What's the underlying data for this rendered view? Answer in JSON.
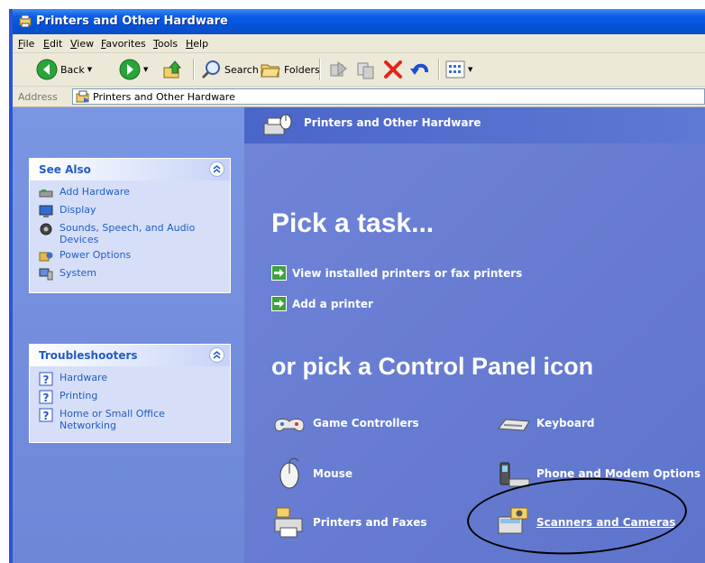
{
  "window": {
    "title": "Printers and Other Hardware"
  },
  "menu": [
    "File",
    "Edit",
    "View",
    "Favorites",
    "Tools",
    "Help"
  ],
  "toolbar": {
    "back": "Back",
    "search": "Search",
    "folders": "Folders"
  },
  "address": {
    "label": "Address",
    "value": "Printers and Other Hardware"
  },
  "see_also": {
    "title": "See Also",
    "items": [
      {
        "label": "Add Hardware",
        "icon": "add-hardware-icon"
      },
      {
        "label": "Display",
        "icon": "display-icon"
      },
      {
        "label": "Sounds, Speech, and Audio Devices",
        "icon": "speaker-icon"
      },
      {
        "label": "Power Options",
        "icon": "power-icon"
      },
      {
        "label": "System",
        "icon": "computer-icon"
      }
    ]
  },
  "troubleshooters": {
    "title": "Troubleshooters",
    "items": [
      {
        "label": "Hardware",
        "icon": "help-icon"
      },
      {
        "label": "Printing",
        "icon": "help-icon"
      },
      {
        "label": "Home or Small Office Networking",
        "icon": "help-icon"
      }
    ]
  },
  "content": {
    "header": "Printers and Other Hardware",
    "pick_task": "Pick a task...",
    "tasks": [
      "View installed printers or fax printers",
      "Add a printer"
    ],
    "pick_icon": "or pick a Control Panel icon",
    "icons": [
      "Game Controllers",
      "Keyboard",
      "Mouse",
      "Phone and Modem Options",
      "Printers and Faxes",
      "Scanners and Cameras"
    ]
  },
  "colors": {
    "title_bar": "#0a5ce6",
    "task_pane": "#7a96e2",
    "content_bg": "#6b80d4",
    "link": "#215dc6"
  }
}
